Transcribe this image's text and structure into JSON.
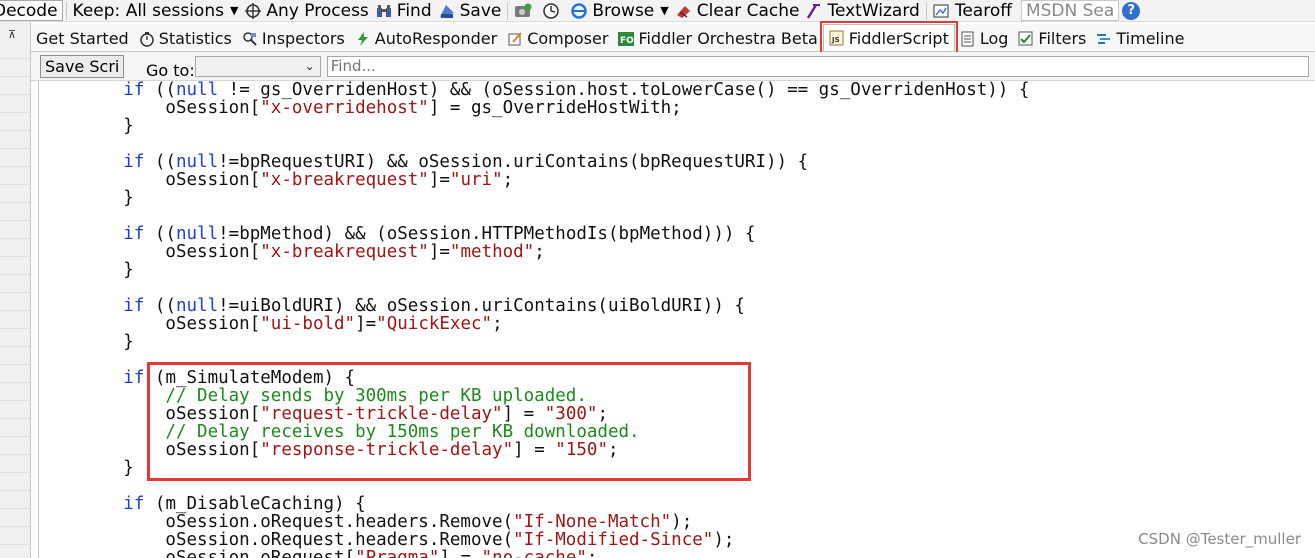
{
  "toolbar": {
    "decode": "Decode",
    "keep": "Keep: All sessions",
    "process": "Any Process",
    "find": "Find",
    "save": "Save",
    "browse": "Browse",
    "clear_cache": "Clear Cache",
    "text_wizard": "TextWizard",
    "tearoff": "Tearoff",
    "msdn": "MSDN Sea"
  },
  "tabs": [
    {
      "label": "Get Started",
      "icon": "none"
    },
    {
      "label": "Statistics",
      "icon": "stopwatch-icon"
    },
    {
      "label": "Inspectors",
      "icon": "inspector-icon"
    },
    {
      "label": "AutoResponder",
      "icon": "lightning-icon"
    },
    {
      "label": "Composer",
      "icon": "composer-icon"
    },
    {
      "label": "Fiddler Orchestra Beta",
      "icon": "fo-icon"
    },
    {
      "label": "FiddlerScript",
      "icon": "js-icon",
      "active": true
    },
    {
      "label": "Log",
      "icon": "log-icon"
    },
    {
      "label": "Filters",
      "icon": "checkbox-icon"
    },
    {
      "label": "Timeline",
      "icon": "timeline-icon"
    }
  ],
  "scriptbar": {
    "save_label": "Save Scri",
    "goto_label": "Go to:",
    "find_placeholder": "Find..."
  },
  "code": [
    [
      [
        "kw",
        "        if "
      ],
      [
        "",
        "(("
      ],
      [
        "kw",
        "null"
      ],
      [
        "",
        " != gs_OverridenHost) && (oSession.host.toLowerCase() == gs_OverridenHost)) {"
      ]
    ],
    [
      [
        "",
        "            oSession["
      ],
      [
        "str",
        "\"x-overridehost\""
      ],
      [
        "",
        "] = gs_OverrideHostWith;"
      ]
    ],
    [
      [
        "",
        "        }"
      ]
    ],
    [
      [
        "",
        ""
      ]
    ],
    [
      [
        "kw",
        "        if "
      ],
      [
        "",
        "(("
      ],
      [
        "kw",
        "null"
      ],
      [
        "",
        "!=bpRequestURI) && oSession.uriContains(bpRequestURI)) {"
      ]
    ],
    [
      [
        "",
        "            oSession["
      ],
      [
        "str",
        "\"x-breakrequest\""
      ],
      [
        "",
        "]="
      ],
      [
        "str",
        "\"uri\""
      ],
      [
        "",
        ";"
      ]
    ],
    [
      [
        "",
        "        }"
      ]
    ],
    [
      [
        "",
        ""
      ]
    ],
    [
      [
        "kw",
        "        if "
      ],
      [
        "",
        "(("
      ],
      [
        "kw",
        "null"
      ],
      [
        "",
        "!=bpMethod) && (oSession.HTTPMethodIs(bpMethod))) {"
      ]
    ],
    [
      [
        "",
        "            oSession["
      ],
      [
        "str",
        "\"x-breakrequest\""
      ],
      [
        "",
        "]="
      ],
      [
        "str",
        "\"method\""
      ],
      [
        "",
        ";"
      ]
    ],
    [
      [
        "",
        "        }"
      ]
    ],
    [
      [
        "",
        ""
      ]
    ],
    [
      [
        "kw",
        "        if "
      ],
      [
        "",
        "(("
      ],
      [
        "kw",
        "null"
      ],
      [
        "",
        "!=uiBoldURI) && oSession.uriContains(uiBoldURI)) {"
      ]
    ],
    [
      [
        "",
        "            oSession["
      ],
      [
        "str",
        "\"ui-bold\""
      ],
      [
        "",
        "]="
      ],
      [
        "str",
        "\"QuickExec\""
      ],
      [
        "",
        ";"
      ]
    ],
    [
      [
        "",
        "        }"
      ]
    ],
    [
      [
        "",
        ""
      ]
    ],
    [
      [
        "kw",
        "        if "
      ],
      [
        "",
        "(m_SimulateModem) {"
      ]
    ],
    [
      [
        "cmt",
        "            // Delay sends by 300ms per KB uploaded."
      ]
    ],
    [
      [
        "",
        "            oSession["
      ],
      [
        "str",
        "\"request-trickle-delay\""
      ],
      [
        "",
        "] = "
      ],
      [
        "str",
        "\"300\""
      ],
      [
        "",
        ";"
      ]
    ],
    [
      [
        "cmt",
        "            // Delay receives by 150ms per KB downloaded."
      ]
    ],
    [
      [
        "",
        "            oSession["
      ],
      [
        "str",
        "\"response-trickle-delay\""
      ],
      [
        "",
        "] = "
      ],
      [
        "str",
        "\"150\""
      ],
      [
        "",
        ";"
      ]
    ],
    [
      [
        "",
        "        }"
      ]
    ],
    [
      [
        "",
        ""
      ]
    ],
    [
      [
        "kw",
        "        if "
      ],
      [
        "",
        "(m_DisableCaching) {"
      ]
    ],
    [
      [
        "",
        "            oSession.oRequest.headers.Remove("
      ],
      [
        "str",
        "\"If-None-Match\""
      ],
      [
        "",
        ");"
      ]
    ],
    [
      [
        "",
        "            oSession.oRequest.headers.Remove("
      ],
      [
        "str",
        "\"If-Modified-Since\""
      ],
      [
        "",
        ");"
      ]
    ],
    [
      [
        "",
        "            oSession.oRequest["
      ],
      [
        "str",
        "\"Pragma\""
      ],
      [
        "",
        "] = "
      ],
      [
        "str",
        "\"no-cache\""
      ],
      [
        "",
        ";"
      ]
    ]
  ],
  "watermark": "CSDN @Tester_muller",
  "colors": {
    "keyword": "#1d3fd1",
    "string": "#a31515",
    "comment": "#1c8a1c",
    "highlight": "#e53935"
  }
}
